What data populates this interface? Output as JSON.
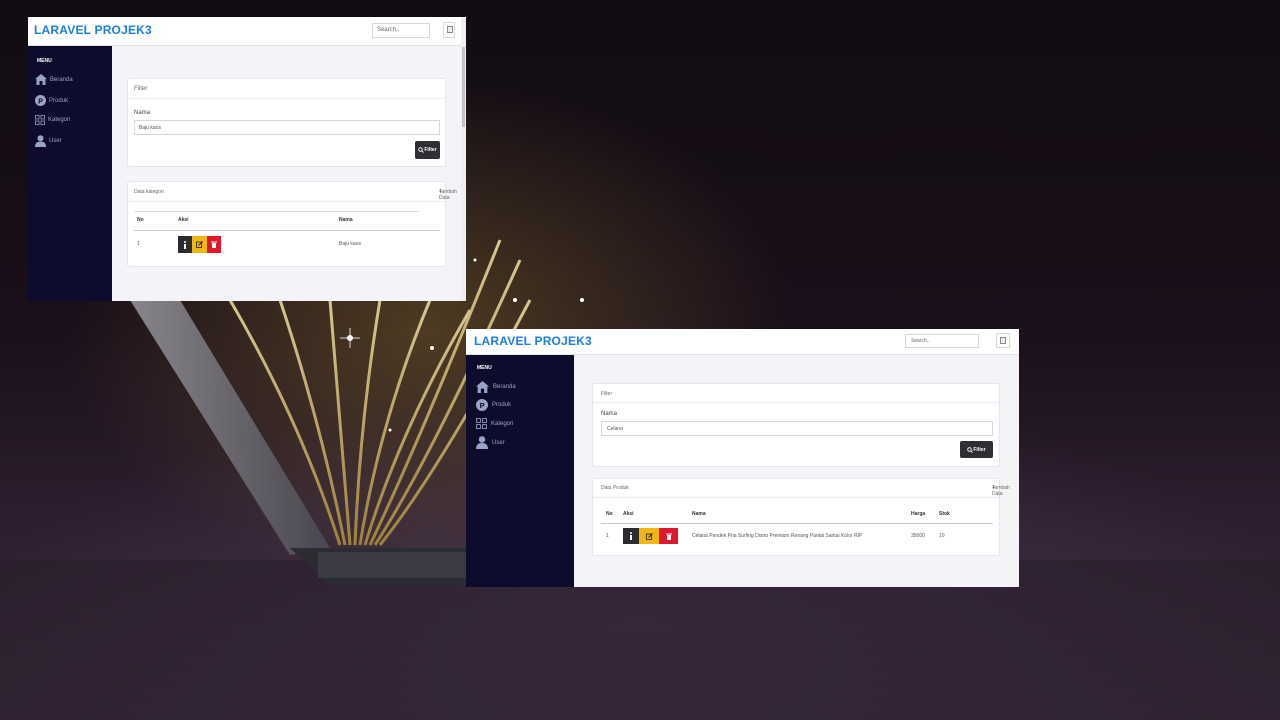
{
  "screenshot_a": {
    "brand": "LARAVEL PROJEK3",
    "search_placeholder": "Search..",
    "menu_title": "MENU",
    "nav": [
      "Beranda",
      "Produk",
      "Kategori",
      "User"
    ],
    "filter": {
      "title": "Filter",
      "field_label": "Nama",
      "field_value": "Baju kaos",
      "button": "Filter"
    },
    "data": {
      "title": "Data kategori",
      "add_label": "Tambah Data",
      "columns": [
        "No",
        "Aksi",
        "Nama"
      ],
      "rows": [
        {
          "no": "1",
          "nama": "Baju kaos"
        }
      ]
    }
  },
  "screenshot_b": {
    "brand": "LARAVEL PROJEK3",
    "search_placeholder": "Search..",
    "menu_title": "MENU",
    "nav": [
      "Beranda",
      "Produk",
      "Kategori",
      "User"
    ],
    "filter": {
      "title": "Filter",
      "field_label": "Nama",
      "field_value": "Celana",
      "button": "Filter"
    },
    "data": {
      "title": "Data Produk",
      "add_label": "Tambah Data",
      "columns": [
        "No",
        "Aksi",
        "Nama",
        "Harga",
        "Stok"
      ],
      "rows": [
        {
          "no": "1",
          "nama": "Celana Pendek Pria Surfing Distro Premium Renang Pantai Santai Kolor RIP",
          "harga": "35000",
          "stok": "10"
        }
      ]
    }
  },
  "icons": {
    "home": "home-icon",
    "produk": "p-circle-icon",
    "kategori": "grid-icon",
    "user": "user-icon",
    "search_button": "magnifier-icon",
    "add": "plus-icon",
    "info": "info-icon",
    "edit": "edit-icon",
    "delete": "trash-icon"
  },
  "colors": {
    "brand": "#1b7fe0",
    "sidebar": "#0e0c2c",
    "btn_dark": "#2e2e33",
    "btn_edit": "#f0b614",
    "btn_delete": "#e0182c"
  }
}
